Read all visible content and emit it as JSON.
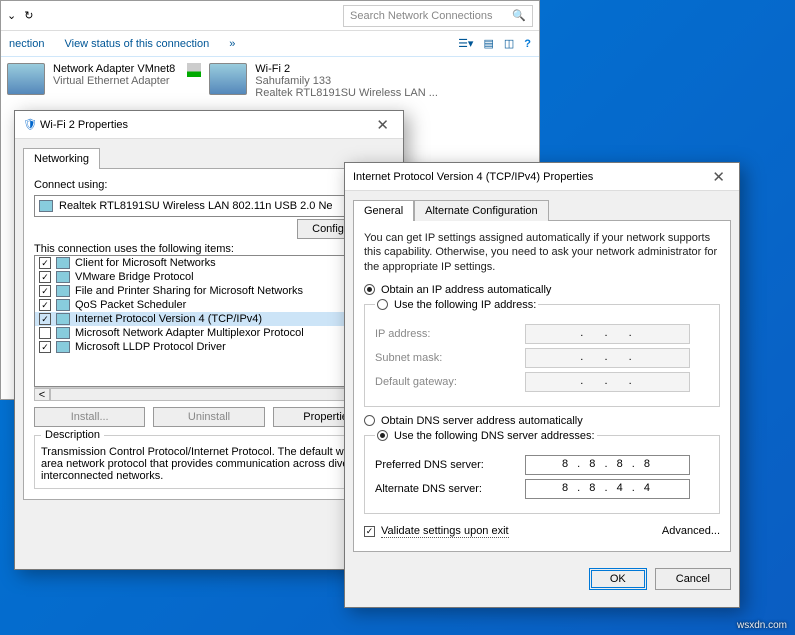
{
  "bg": {
    "searchPlaceholder": "Search Network Connections",
    "link1": "nection",
    "link2": "View status of this connection",
    "adapter1_line1": "Network Adapter VMnet8",
    "adapter1_line2": "Virtual Ethernet Adapter",
    "adapter2_line1": "Wi-Fi 2",
    "adapter2_line2": "Sahufamily  133",
    "adapter2_line3": "Realtek RTL8191SU Wireless LAN ..."
  },
  "dlg1": {
    "title": "Wi-Fi 2 Properties",
    "tab": "Networking",
    "connectUsing": "Connect using:",
    "adapter": "Realtek RTL8191SU Wireless LAN 802.11n USB 2.0 Ne",
    "configure": "Configure...",
    "itemsLabel": "This connection uses the following items:",
    "items": [
      {
        "checked": true,
        "label": "Client for Microsoft Networks"
      },
      {
        "checked": true,
        "label": "VMware Bridge Protocol"
      },
      {
        "checked": true,
        "label": "File and Printer Sharing for Microsoft Networks"
      },
      {
        "checked": true,
        "label": "QoS Packet Scheduler"
      },
      {
        "checked": true,
        "label": "Internet Protocol Version 4 (TCP/IPv4)",
        "sel": true
      },
      {
        "checked": false,
        "label": "Microsoft Network Adapter Multiplexor Protocol"
      },
      {
        "checked": true,
        "label": "Microsoft LLDP Protocol Driver"
      }
    ],
    "install": "Install...",
    "uninstall": "Uninstall",
    "properties": "Properties",
    "descLbl": "Description",
    "descText": "Transmission Control Protocol/Internet Protocol. The default wide area network protocol that provides communication across diverse interconnected networks."
  },
  "dlg2": {
    "title": "Internet Protocol Version 4 (TCP/IPv4) Properties",
    "tabGeneral": "General",
    "tabAlt": "Alternate Configuration",
    "desc": "You can get IP settings assigned automatically if your network supports this capability. Otherwise, you need to ask your network administrator for the appropriate IP settings.",
    "rObtainIP": "Obtain an IP address automatically",
    "rUseIP": "Use the following IP address:",
    "lIP": "IP address:",
    "lMask": "Subnet mask:",
    "lGw": "Default gateway:",
    "rObtainDNS": "Obtain DNS server address automatically",
    "rUseDNS": "Use the following DNS server addresses:",
    "lDns1": "Preferred DNS server:",
    "lDns2": "Alternate DNS server:",
    "dns1": "8 . 8 . 8 . 8",
    "dns2": "8 . 8 . 4 . 4",
    "validate": "Validate settings upon exit",
    "advanced": "Advanced...",
    "ok": "OK",
    "cancel": "Cancel"
  },
  "watermark": "wsxdn.com"
}
